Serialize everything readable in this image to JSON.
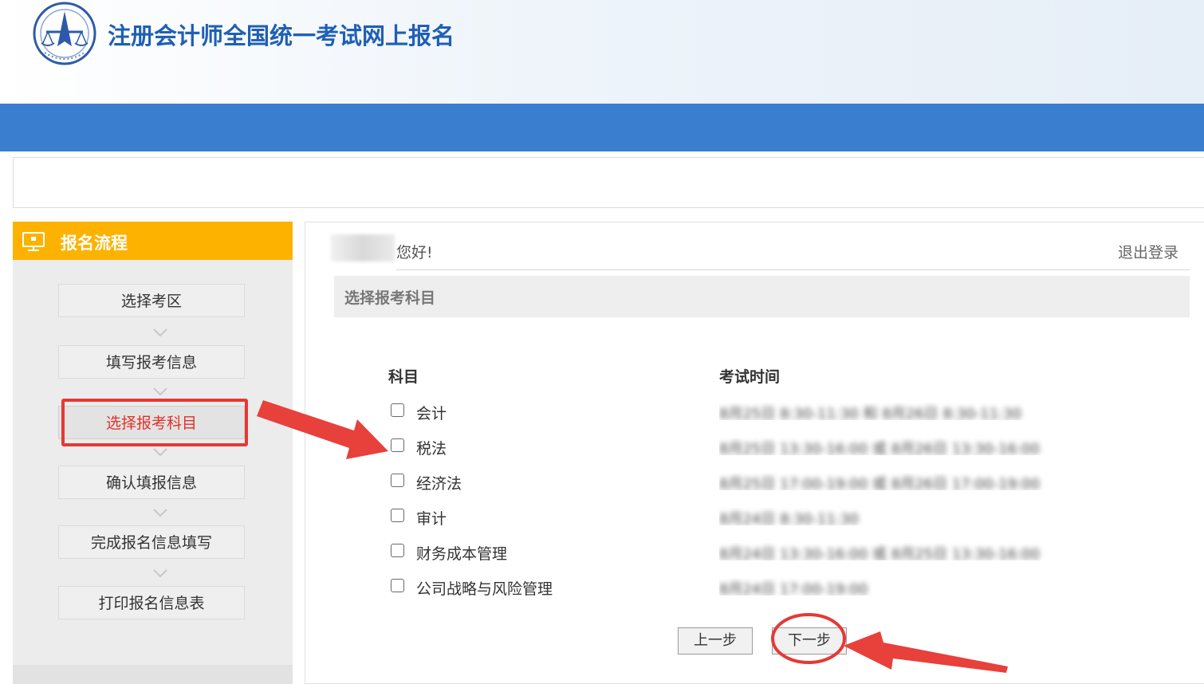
{
  "header": {
    "site_title": "注册会计师全国统一考试网上报名"
  },
  "sidebar": {
    "title": "报名流程",
    "steps": [
      {
        "label": "选择考区"
      },
      {
        "label": "填写报考信息"
      },
      {
        "label": "选择报考科目"
      },
      {
        "label": "确认填报信息"
      },
      {
        "label": "完成报名信息填写"
      },
      {
        "label": "打印报名信息表"
      }
    ],
    "active_step": "选择报考科目"
  },
  "main": {
    "greeting": "您好!",
    "logout_label": "退出登录",
    "section_title": "选择报考科目",
    "columns": {
      "subject": "科目",
      "exam_time": "考试时间"
    },
    "subjects": [
      {
        "name": "会计",
        "time": "8月25日 8:30-11:30 和 8月26日 8:30-11:30",
        "checked": false
      },
      {
        "name": "税法",
        "time": "8月25日 13:30-16:00 或 8月26日 13:30-16:00",
        "checked": false
      },
      {
        "name": "经济法",
        "time": "8月25日 17:00-19:00 或 8月26日 17:00-19:00",
        "checked": false
      },
      {
        "name": "审计",
        "time": "8月24日 8:30-11:30",
        "checked": false
      },
      {
        "name": "财务成本管理",
        "time": "8月24日 13:30-16:00 或 8月25日 13:30-16:00",
        "checked": false
      },
      {
        "name": "公司战略与风险管理",
        "time": "8月24日 17:00-19:00",
        "checked": false
      }
    ],
    "prev_button": "上一步",
    "next_button": "下一步"
  },
  "colors": {
    "brand_blue": "#3a7fcf",
    "title_blue": "#1f5fb5",
    "sidebar_header": "#fdb200",
    "annotation_red": "#e53935"
  }
}
